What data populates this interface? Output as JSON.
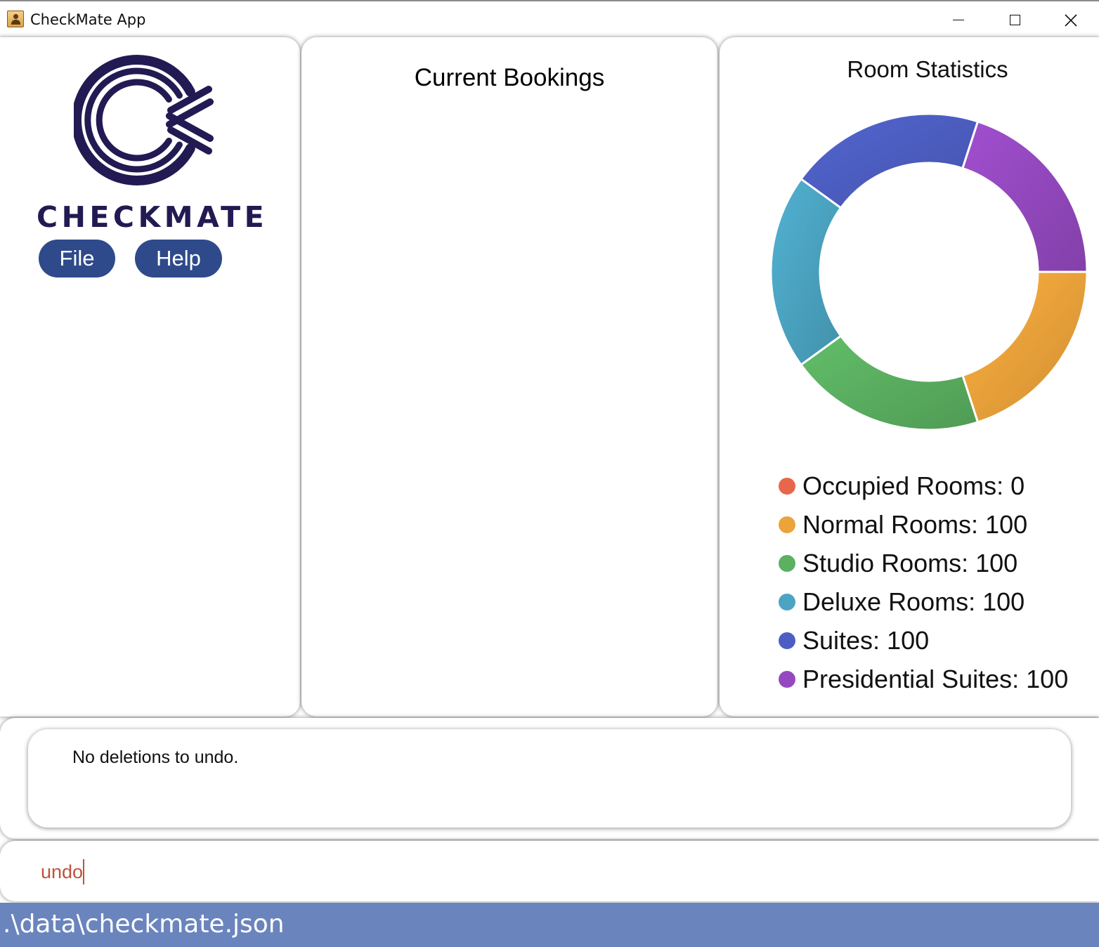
{
  "window": {
    "title": "CheckMate App"
  },
  "sidebar": {
    "brand": "CHECKMATE",
    "menu": [
      {
        "label": "File"
      },
      {
        "label": "Help"
      }
    ]
  },
  "bookings": {
    "title": "Current Bookings",
    "items": []
  },
  "statistics": {
    "title": "Room Statistics",
    "legend": [
      {
        "label": "Occupied Rooms: 0",
        "color": "#e8674a"
      },
      {
        "label": "Normal Rooms: 100",
        "color": "#eba33a"
      },
      {
        "label": "Studio Rooms: 100",
        "color": "#5bb061"
      },
      {
        "label": "Deluxe Rooms: 100",
        "color": "#4ba5c2"
      },
      {
        "label": "Suites: 100",
        "color": "#4d5ec2"
      },
      {
        "label": "Presidential Suites: 100",
        "color": "#9549c0"
      }
    ]
  },
  "chart_data": {
    "type": "pie",
    "variant": "donut",
    "title": "Room Statistics",
    "categories": [
      "Occupied Rooms",
      "Normal Rooms",
      "Studio Rooms",
      "Deluxe Rooms",
      "Suites",
      "Presidential Suites"
    ],
    "values": [
      0,
      100,
      100,
      100,
      100,
      100
    ],
    "colors": [
      "#e8674a",
      "#eba33a",
      "#5bb061",
      "#4ba5c2",
      "#4d5ec2",
      "#9549c0"
    ],
    "legend": "bottom"
  },
  "result": {
    "message": "No deletions to undo."
  },
  "command": {
    "value": "undo"
  },
  "status": {
    "file_path": ".\\data\\checkmate.json"
  }
}
